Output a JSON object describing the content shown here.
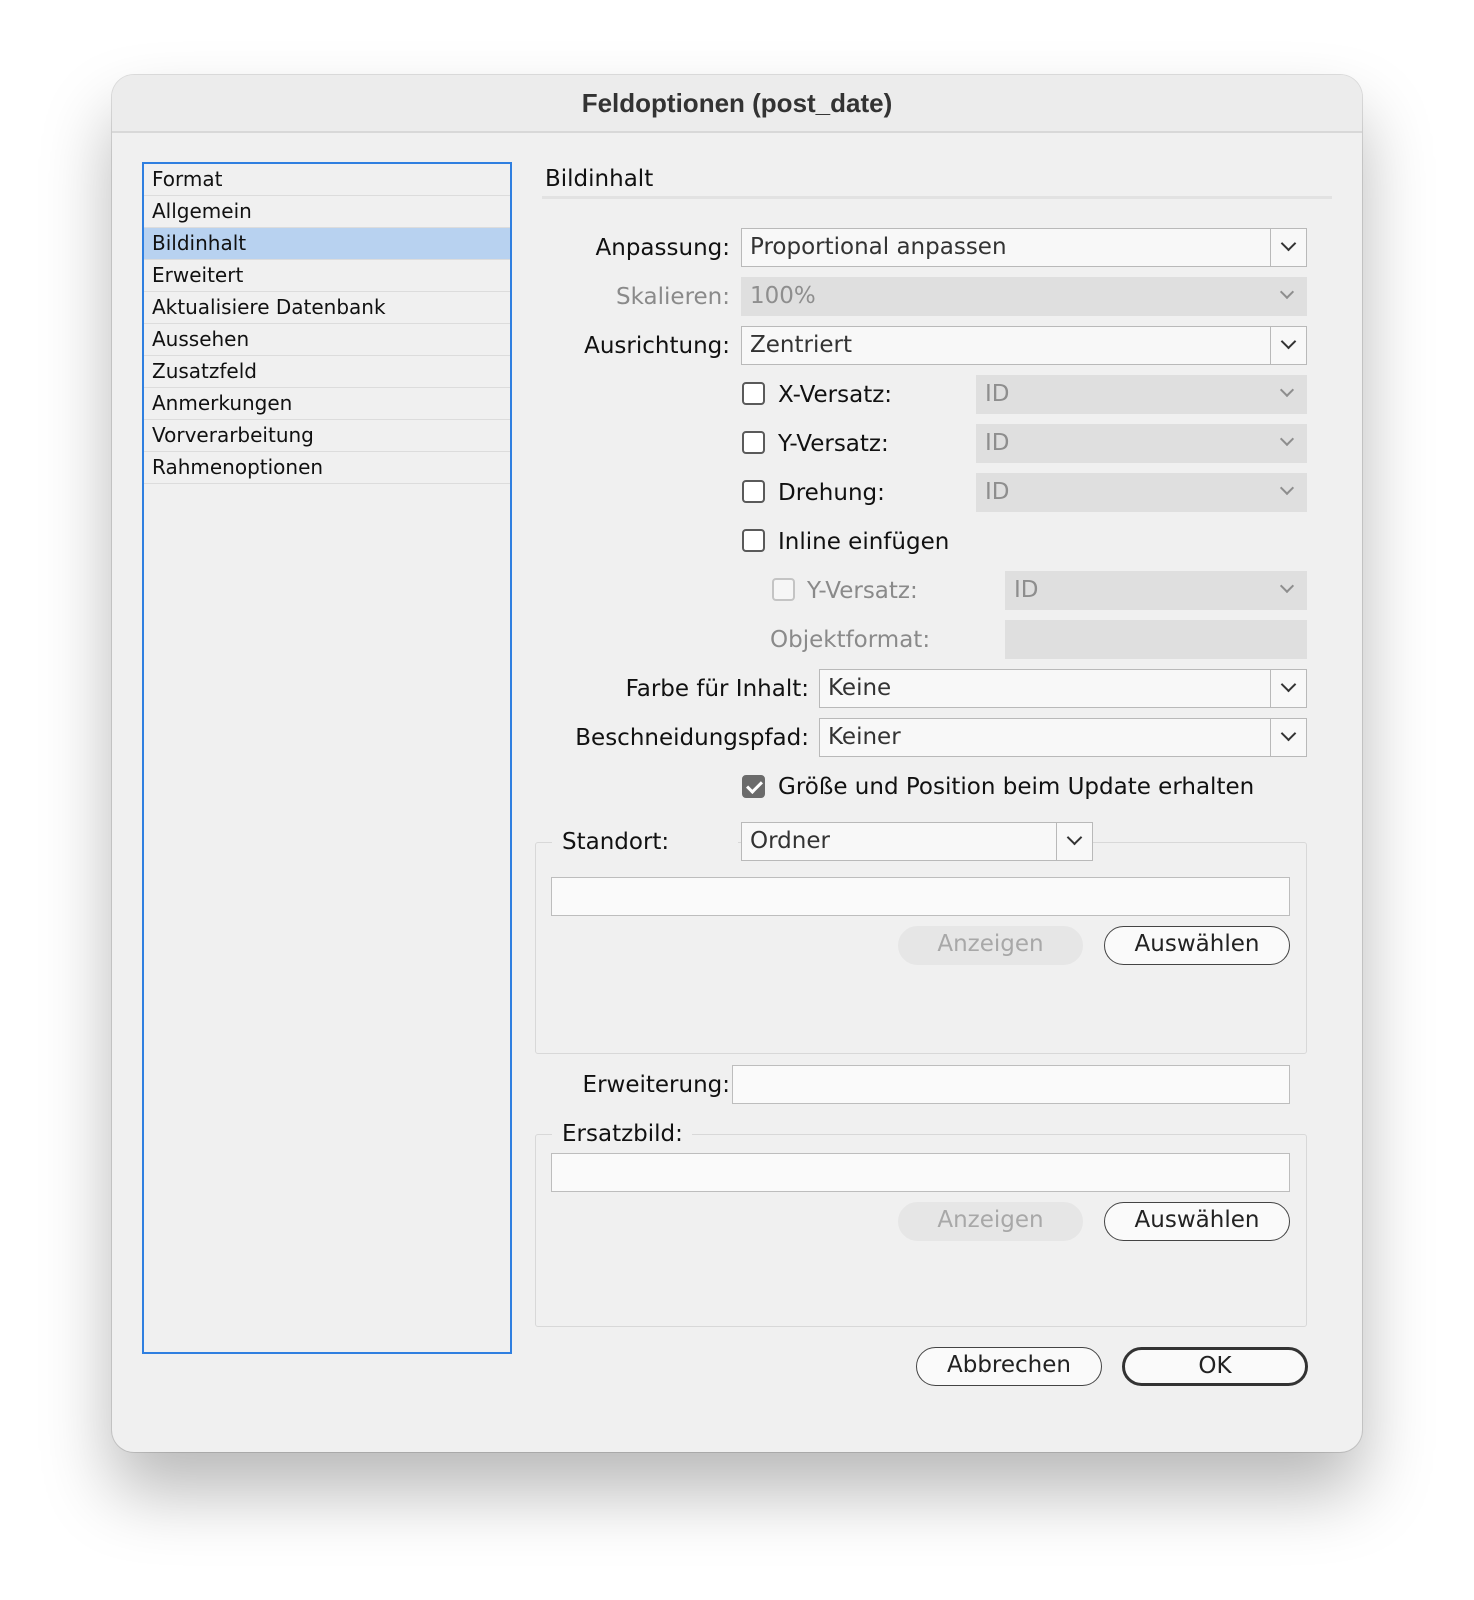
{
  "window": {
    "title": "Feldoptionen (post_date)"
  },
  "sidebar": {
    "items": [
      {
        "label": "Format"
      },
      {
        "label": "Allgemein"
      },
      {
        "label": "Bildinhalt",
        "selected": true
      },
      {
        "label": "Erweitert"
      },
      {
        "label": "Aktualisiere Datenbank"
      },
      {
        "label": "Aussehen"
      },
      {
        "label": "Zusatzfeld"
      },
      {
        "label": "Anmerkungen"
      },
      {
        "label": "Vorverarbeitung"
      },
      {
        "label": "Rahmenoptionen"
      }
    ]
  },
  "panel": {
    "title": "Bildinhalt",
    "anpassung": {
      "label": "Anpassung:",
      "value": "Proportional anpassen"
    },
    "skalieren": {
      "label": "Skalieren:",
      "value": "100%",
      "disabled": true
    },
    "ausrichtung": {
      "label": "Ausrichtung:",
      "value": "Zentriert"
    },
    "x_versatz": {
      "label": "X-Versatz:",
      "value": "ID",
      "checked": false
    },
    "y_versatz": {
      "label": "Y-Versatz:",
      "value": "ID",
      "checked": false
    },
    "drehung": {
      "label": "Drehung:",
      "value": "ID",
      "checked": false
    },
    "inline": {
      "label": "Inline einfügen",
      "checked": false
    },
    "inline_y_versatz": {
      "label": "Y-Versatz:",
      "value": "ID",
      "checked": false,
      "disabled": true
    },
    "objektformat": {
      "label": "Objektformat:",
      "value": ""
    },
    "farbe": {
      "label": "Farbe für Inhalt:",
      "value": "Keine"
    },
    "beschneidungspfad": {
      "label": "Beschneidungspfad:",
      "value": "Keiner"
    },
    "groesse": {
      "label": "Größe und Position beim Update erhalten",
      "checked": true
    },
    "standort": {
      "label": "Standort:",
      "value": "Ordner",
      "path": "",
      "show_label": "Anzeigen",
      "choose_label": "Auswählen"
    },
    "erweiterung": {
      "label": "Erweiterung:",
      "value": ""
    },
    "ersatzbild": {
      "label": "Ersatzbild:",
      "path": "",
      "show_label": "Anzeigen",
      "choose_label": "Auswählen"
    }
  },
  "footer": {
    "cancel_label": "Abbrechen",
    "ok_label": "OK"
  },
  "colors": {
    "selection": "#b8d2f0",
    "focus_ring": "#2f7fe0",
    "background": "#f0f0f0"
  }
}
